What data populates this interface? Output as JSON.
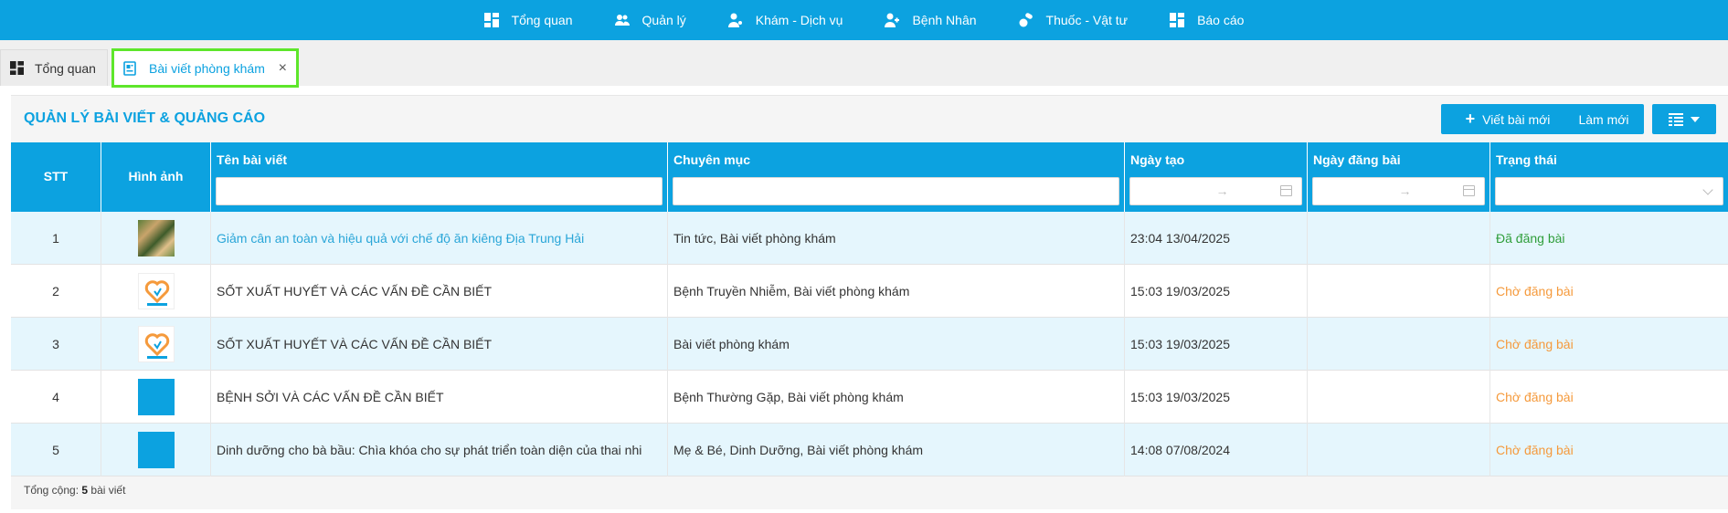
{
  "nav": {
    "items": [
      {
        "label": "Tổng quan",
        "icon": "dashboard-icon"
      },
      {
        "label": "Quản lý",
        "icon": "users-icon"
      },
      {
        "label": "Khám - Dịch vụ",
        "icon": "doctor-icon"
      },
      {
        "label": "Bệnh Nhân",
        "icon": "patient-icon"
      },
      {
        "label": "Thuốc - Vật tư",
        "icon": "pills-icon"
      },
      {
        "label": "Báo cáo",
        "icon": "report-icon"
      }
    ]
  },
  "tabs": {
    "home": "Tổng quan",
    "active": "Bài viết phòng khám",
    "close": "×"
  },
  "panel": {
    "title": "QUẢN LÝ BÀI VIẾT & QUẢNG CÁO",
    "new_button": "Viết bài mới",
    "refresh_button": "Làm mới"
  },
  "table": {
    "columns": {
      "stt": "STT",
      "image": "Hình ảnh",
      "title": "Tên bài viết",
      "category": "Chuyên mục",
      "created": "Ngày tạo",
      "published": "Ngày đăng bài",
      "status": "Trạng thái"
    },
    "range_arrow": "→",
    "rows": [
      {
        "stt": "1",
        "thumb": "food",
        "title": "Giảm cân an toàn và hiệu quả với chế độ ăn kiêng Địa Trung Hải",
        "category": "Tin tức, Bài viết phòng khám",
        "created": "23:04 13/04/2025",
        "published": "",
        "status": "Đã đăng bài",
        "status_kind": "posted"
      },
      {
        "stt": "2",
        "thumb": "logo",
        "title": "SỐT XUẤT HUYẾT VÀ CÁC VẤN ĐỀ CẦN BIẾT",
        "category": "Bệnh Truyền Nhiễm, Bài viết phòng khám",
        "created": "15:03 19/03/2025",
        "published": "",
        "status": "Chờ đăng bài",
        "status_kind": "pending"
      },
      {
        "stt": "3",
        "thumb": "logo",
        "title": "SỐT XUẤT HUYẾT VÀ CÁC VẤN ĐỀ CẦN BIẾT",
        "category": "Bài viết phòng khám",
        "created": "15:03 19/03/2025",
        "published": "",
        "status": "Chờ đăng bài",
        "status_kind": "pending"
      },
      {
        "stt": "4",
        "thumb": "blue",
        "title": "BỆNH SỞI VÀ CÁC VẤN ĐỀ CẦN BIẾT",
        "category": "Bệnh Thường Gặp, Bài viết phòng khám",
        "created": "15:03 19/03/2025",
        "published": "",
        "status": "Chờ đăng bài",
        "status_kind": "pending"
      },
      {
        "stt": "5",
        "thumb": "blue",
        "title": "Dinh dưỡng cho bà bầu: Chìa khóa cho sự phát triển toàn diện của thai nhi",
        "category": "Mẹ & Bé, Dinh Dưỡng, Bài viết phòng khám",
        "created": "14:08 07/08/2024",
        "published": "",
        "status": "Chờ đăng bài",
        "status_kind": "pending"
      }
    ]
  },
  "footer": {
    "prefix": "Tổng cộng: ",
    "count": "5",
    "suffix": " bài viết"
  },
  "colors": {
    "accent": "#0ca2e0",
    "posted": "#2f9e3b",
    "pending": "#f59a3c",
    "tab_highlight": "#5ee62b"
  }
}
